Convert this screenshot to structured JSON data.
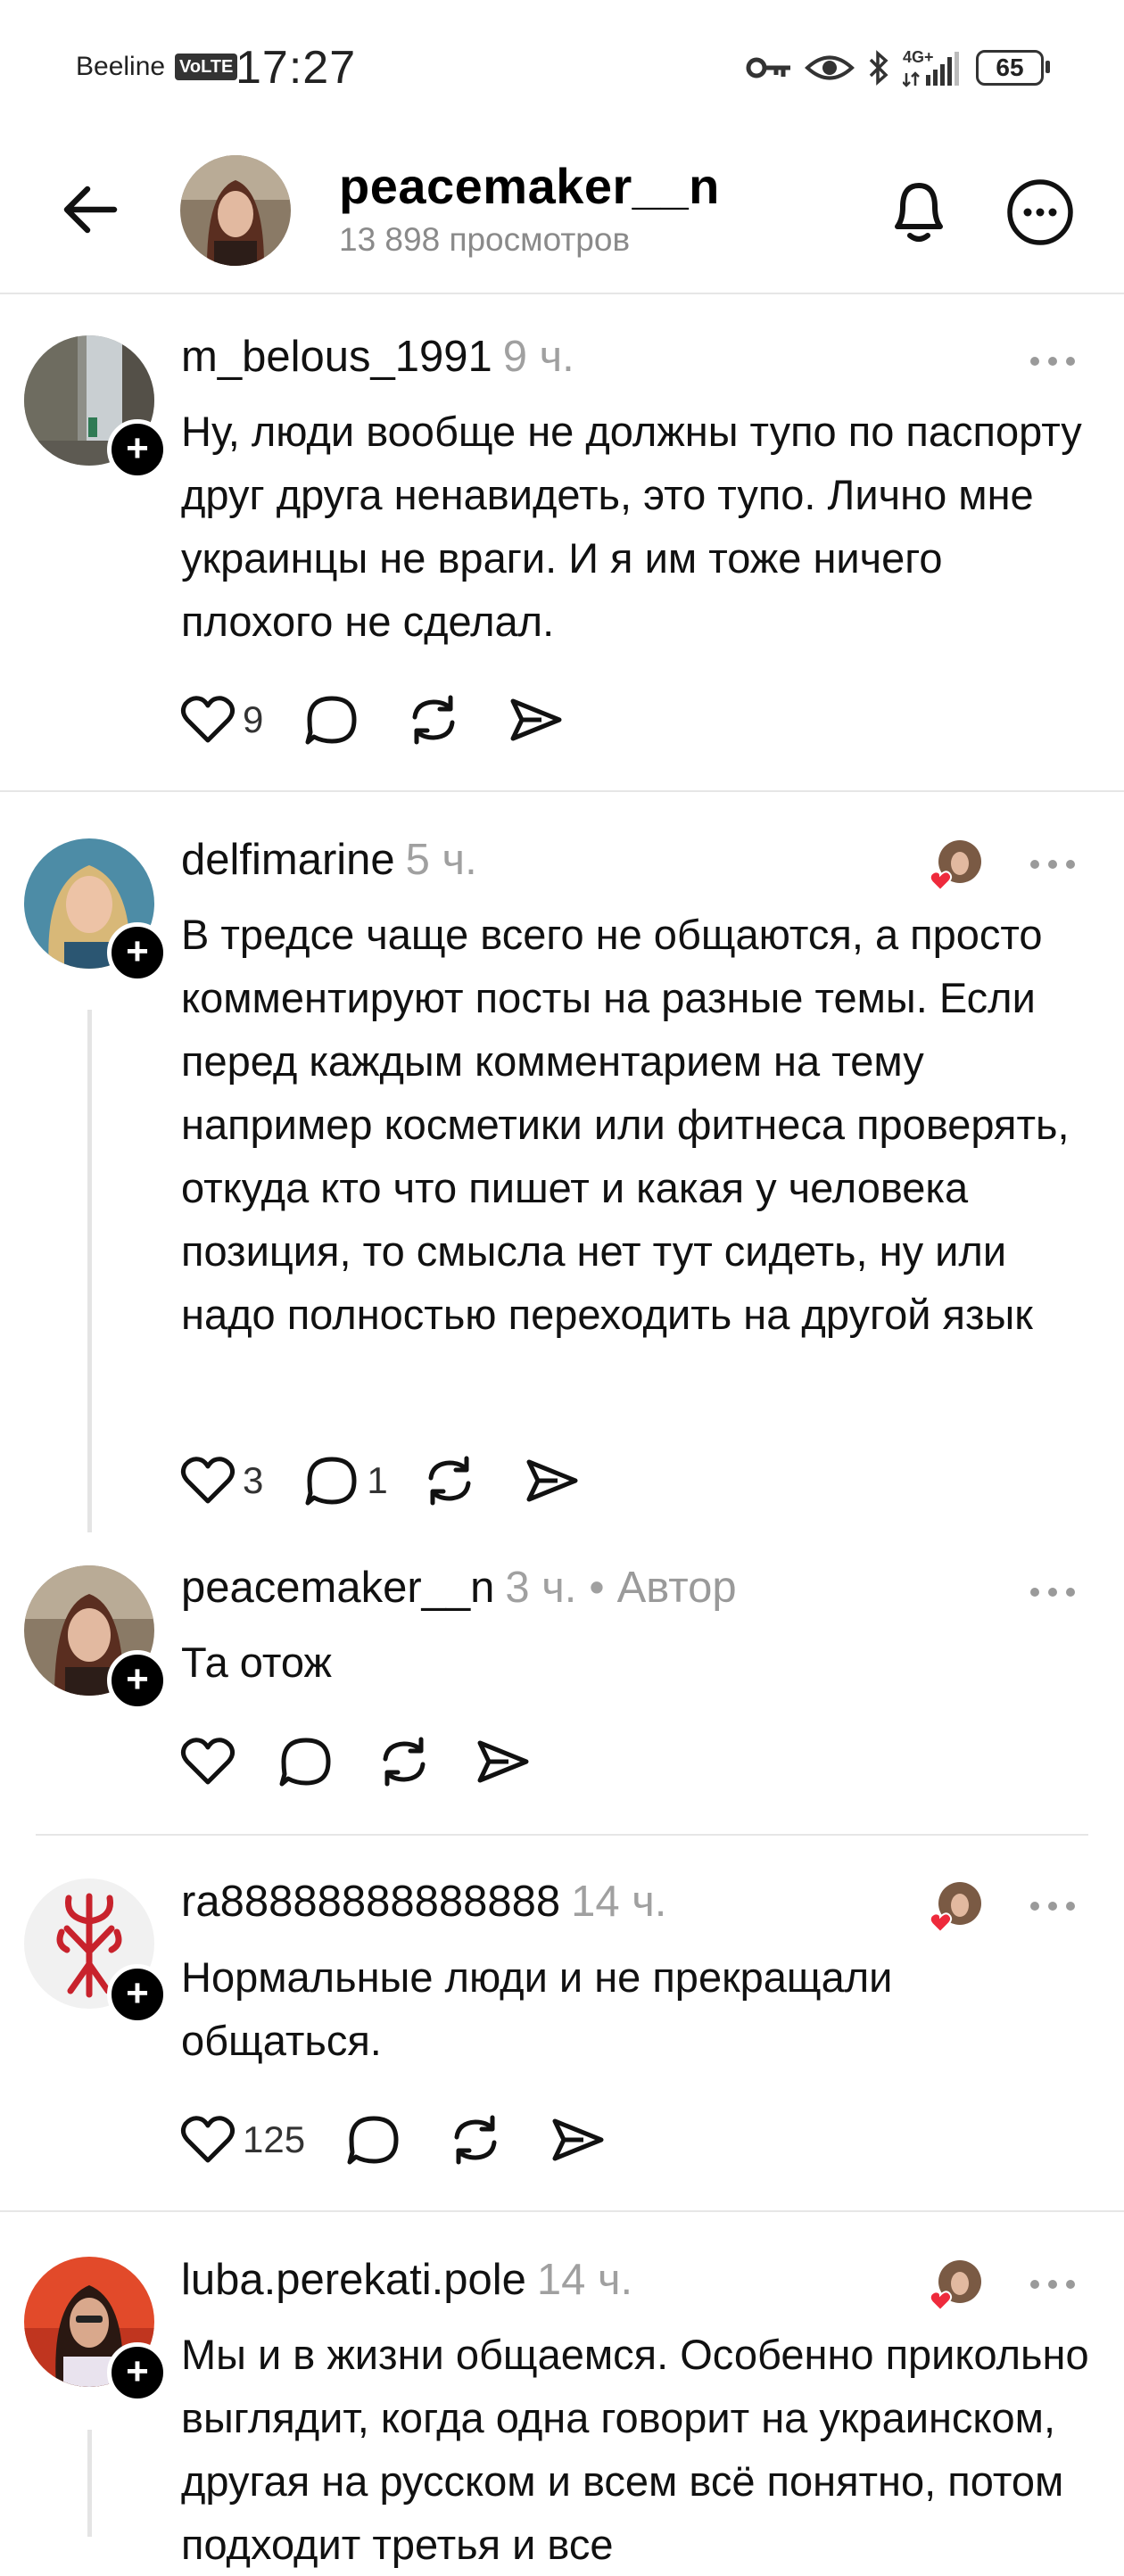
{
  "status_bar": {
    "carrier": "Beeline",
    "volte": "VoLTE",
    "time": "17:27",
    "network": "4G+",
    "battery": "65"
  },
  "header": {
    "username": "peacemaker__n",
    "views": "13 898 просмотров"
  },
  "comments": [
    {
      "username": "m_belous_1991",
      "time": "9 ч.",
      "text": "Ну, люди вообще не должны тупо по паспорту друг друга ненавидеть, это тупо. Лично мне украинцы не враги. И я им тоже ничего плохого не сделал.",
      "likes": "9",
      "replies": ""
    },
    {
      "username": "delfimarine",
      "time": "5 ч.",
      "text": "В тредсе чаще всего не общаются, а просто комментируют посты на разные темы. Если перед каждым комментарием на тему например косметики или фитнеса проверять, откуда кто что пишет и какая у человека позиция, то смысла нет тут сидеть, ну или надо полностью переходить на другой язык",
      "likes": "3",
      "replies": "1"
    },
    {
      "username": "peacemaker__n",
      "time": "3 ч.",
      "author_label": "Автор",
      "separator": "•",
      "text": "Та отож",
      "likes": "",
      "replies": ""
    },
    {
      "username": "ra88888888888888",
      "time": "14 ч.",
      "text": "Нормальные люди и не прекращали общаться.",
      "likes": "125",
      "replies": ""
    },
    {
      "username": "luba.perekati.pole",
      "time": "14 ч.",
      "text": "Мы и в жизни общаемся. Особенно прикольно выглядит, когда одна говорит на украинском, другая на русском и всем всё понятно, потом подходит третья и все",
      "likes": "",
      "replies": ""
    }
  ],
  "colors": {
    "heart_liked": "#ee2a3c",
    "muted": "#a0a0a0",
    "divider": "#e6e6e6"
  }
}
